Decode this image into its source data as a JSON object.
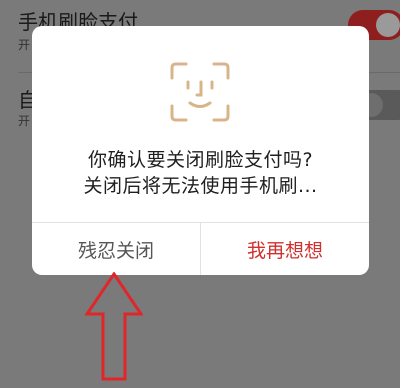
{
  "background": {
    "row1": {
      "title": "手机刷脸支付",
      "subtitle": "开"
    },
    "row2": {
      "title": "自",
      "subtitle": "开"
    }
  },
  "dialog": {
    "icon": "face-id-icon",
    "message_line1": "你确认要关闭刷脸支付吗?",
    "message_line2": "关闭后将无法使用手机刷...",
    "cancel_label": "残忍关闭",
    "confirm_label": "我再想想"
  },
  "annotation": {
    "icon": "red-arrow-up-icon"
  },
  "colors": {
    "accent": "#d0312d",
    "overlay": "#7a7a7a"
  }
}
